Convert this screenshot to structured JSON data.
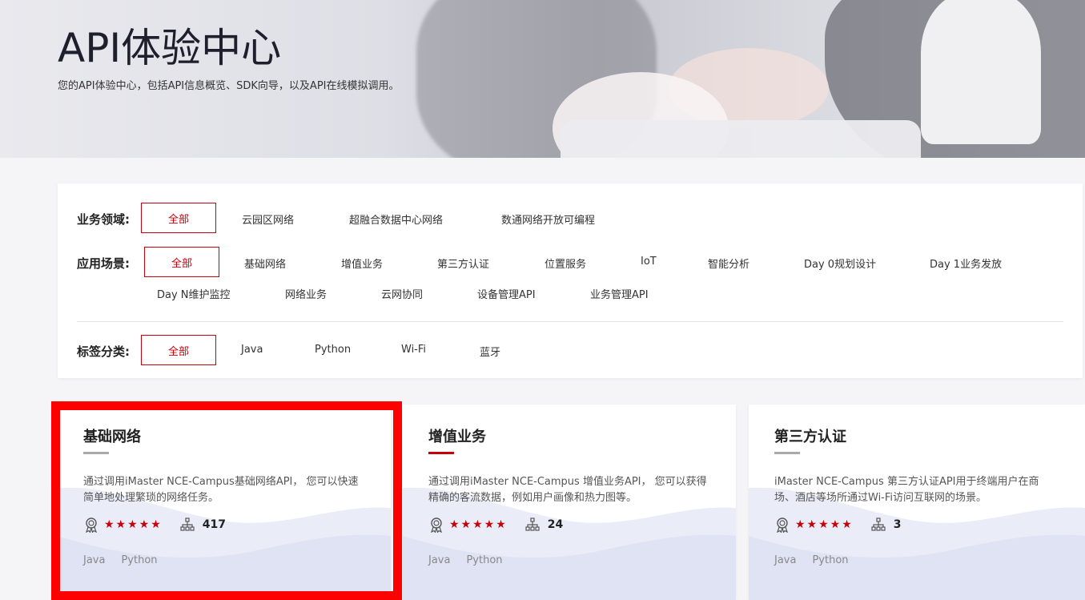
{
  "hero": {
    "title": "API体验中心",
    "subtitle": "您的API体验中心，包括API信息概览、SDK向导，以及API在线模拟调用。"
  },
  "filters": {
    "domain": {
      "label": "业务领域:",
      "selected": "全部",
      "options": [
        "云园区网络",
        "超融合数据中心网络",
        "数通网络开放可编程"
      ]
    },
    "scenario": {
      "label": "应用场景:",
      "selected": "全部",
      "options_row1": [
        "基础网络",
        "增值业务",
        "第三方认证",
        "位置服务",
        "IoT",
        "智能分析",
        "Day 0规划设计",
        "Day 1业务发放"
      ],
      "options_row2": [
        "Day N维护监控",
        "网络业务",
        "云网协同",
        "设备管理API",
        "业务管理API"
      ]
    },
    "tag": {
      "label": "标签分类:",
      "selected": "全部",
      "options": [
        "Java",
        "Python",
        "Wi-Fi",
        "蓝牙"
      ]
    }
  },
  "cards": [
    {
      "title": "基础网络",
      "desc": "通过调用iMaster NCE-Campus基础网络API， 您可以快速简单地处理繁琐的网络任务。",
      "stars": "★★★★★",
      "count": "417",
      "tags": [
        "Java",
        "Python"
      ]
    },
    {
      "title": "增值业务",
      "desc": "通过调用iMaster NCE-Campus 增值业务API， 您可以获得精确的客流数据，例如用户画像和热力图等。",
      "stars": "★★★★★",
      "count": "24",
      "tags": [
        "Java",
        "Python"
      ]
    },
    {
      "title": "第三方认证",
      "desc": "iMaster NCE-Campus 第三方认证API用于终端用户在商场、酒店等场所通过Wi-Fi访问互联网的场景。",
      "stars": "★★★★★",
      "count": "3",
      "tags": [
        "Java",
        "Python"
      ]
    }
  ],
  "colors": {
    "accent": "#c7000b",
    "highlight": "#ff0000",
    "wave": "#dfe3f4"
  }
}
